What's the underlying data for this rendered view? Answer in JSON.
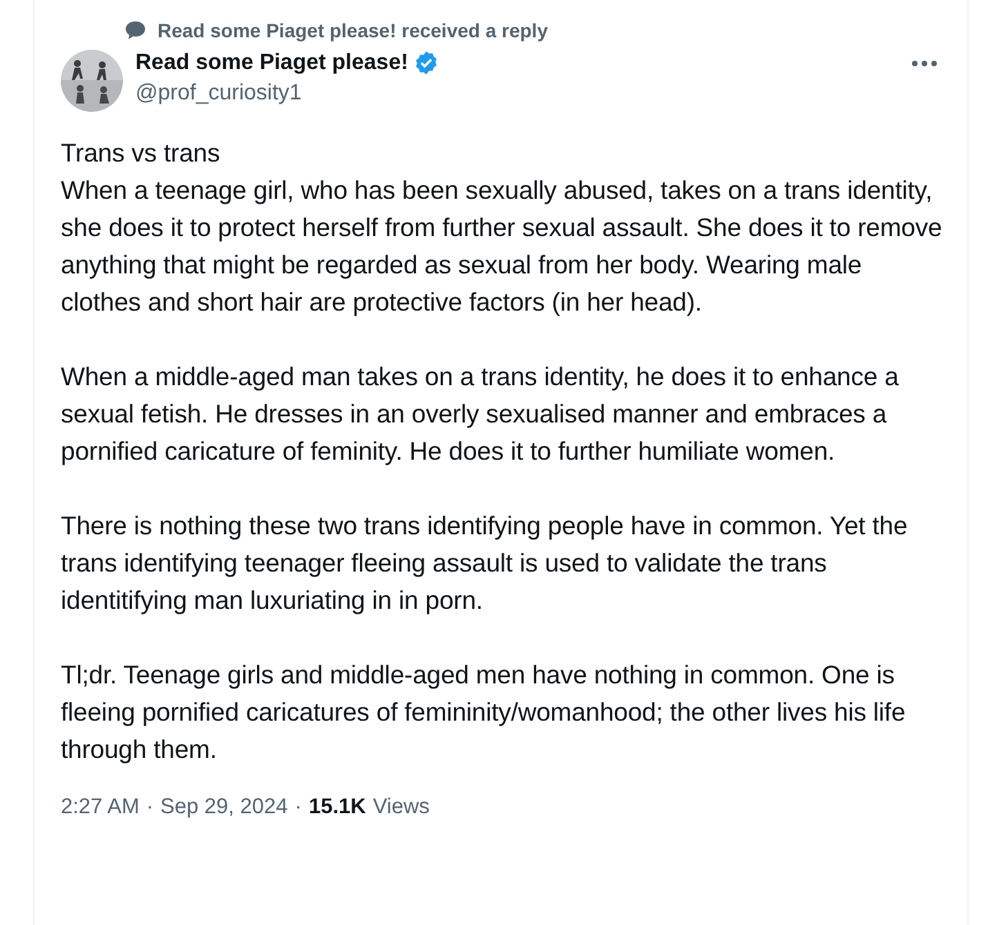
{
  "context": {
    "text": "Read some Piaget please! received a reply"
  },
  "author": {
    "name": "Read some Piaget please!",
    "verified": true,
    "handle": "@prof_curiosity1"
  },
  "paragraphs": [
    "Trans vs trans\nWhen a teenage girl, who has been sexually abused, takes on a trans identity, she does it to protect herself from further sexual assault. She does it to remove anything that might be regarded as sexual from her body. Wearing male clothes and short hair are protective factors (in her head).",
    "When a middle-aged man takes on a trans identity, he does it to enhance a sexual fetish. He dresses in an overly sexualised manner and embraces a pornified caricature of feminity. He does it to  further humiliate women.",
    "There is nothing these two trans identifying people have in common. Yet the trans identifying teenager fleeing assault is used to validate the trans identitifying man luxuriating in in porn.",
    "Tl;dr. Teenage girls and middle-aged men have nothing in common. One is fleeing pornified caricatures of femininity/womanhood; the other lives his life through them."
  ],
  "meta": {
    "time": "2:27 AM",
    "separator_1": "·",
    "date": "Sep 29, 2024",
    "separator_2": "·",
    "views_count": "15.1K",
    "views_label": "Views"
  }
}
